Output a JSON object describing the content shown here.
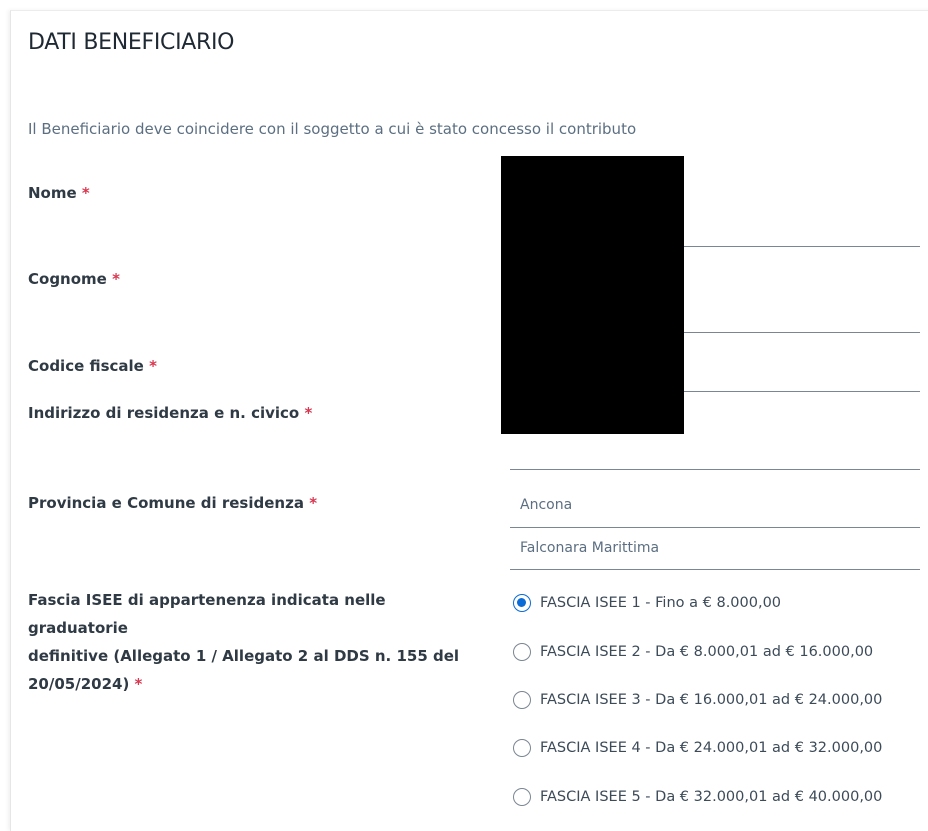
{
  "section": {
    "title": "DATI BENEFICIARIO",
    "description": "Il Beneficiario deve coincidere con il soggetto a cui è stato concesso il contributo"
  },
  "fields": {
    "nome": {
      "label": "Nome",
      "required_mark": "*"
    },
    "cognome": {
      "label": "Cognome",
      "required_mark": "*"
    },
    "codice_fiscale": {
      "label": "Codice fiscale",
      "required_mark": "*"
    },
    "indirizzo": {
      "label": "Indirizzo di residenza e n. civico",
      "required_mark": "*"
    },
    "provincia_comune": {
      "label": "Provincia e Comune di residenza",
      "required_mark": "*",
      "provincia_value": "Ancona",
      "comune_value": "Falconara Marittima"
    },
    "fascia_isee": {
      "label_line1": "Fascia ISEE di appartenenza indicata nelle graduatorie",
      "label_line2": "definitive (Allegato 1 / Allegato 2 al DDS n. 155 del",
      "label_line3": "20/05/2024)",
      "required_mark": "*",
      "options": [
        {
          "label": "FASCIA ISEE 1 - Fino a € 8.000,00",
          "selected": true
        },
        {
          "label": "FASCIA ISEE 2 - Da € 8.000,01 ad € 16.000,00",
          "selected": false
        },
        {
          "label": "FASCIA ISEE 3 - Da € 16.000,01 ad € 24.000,00",
          "selected": false
        },
        {
          "label": "FASCIA ISEE 4 - Da € 24.000,01 ad € 32.000,00",
          "selected": false
        },
        {
          "label": "FASCIA ISEE 5 - Da € 32.000,01 ad € 40.000,00",
          "selected": false
        }
      ]
    }
  },
  "colors": {
    "accent": "#0a6cd6",
    "required": "#d9364f",
    "text_muted": "#5c6f82"
  }
}
